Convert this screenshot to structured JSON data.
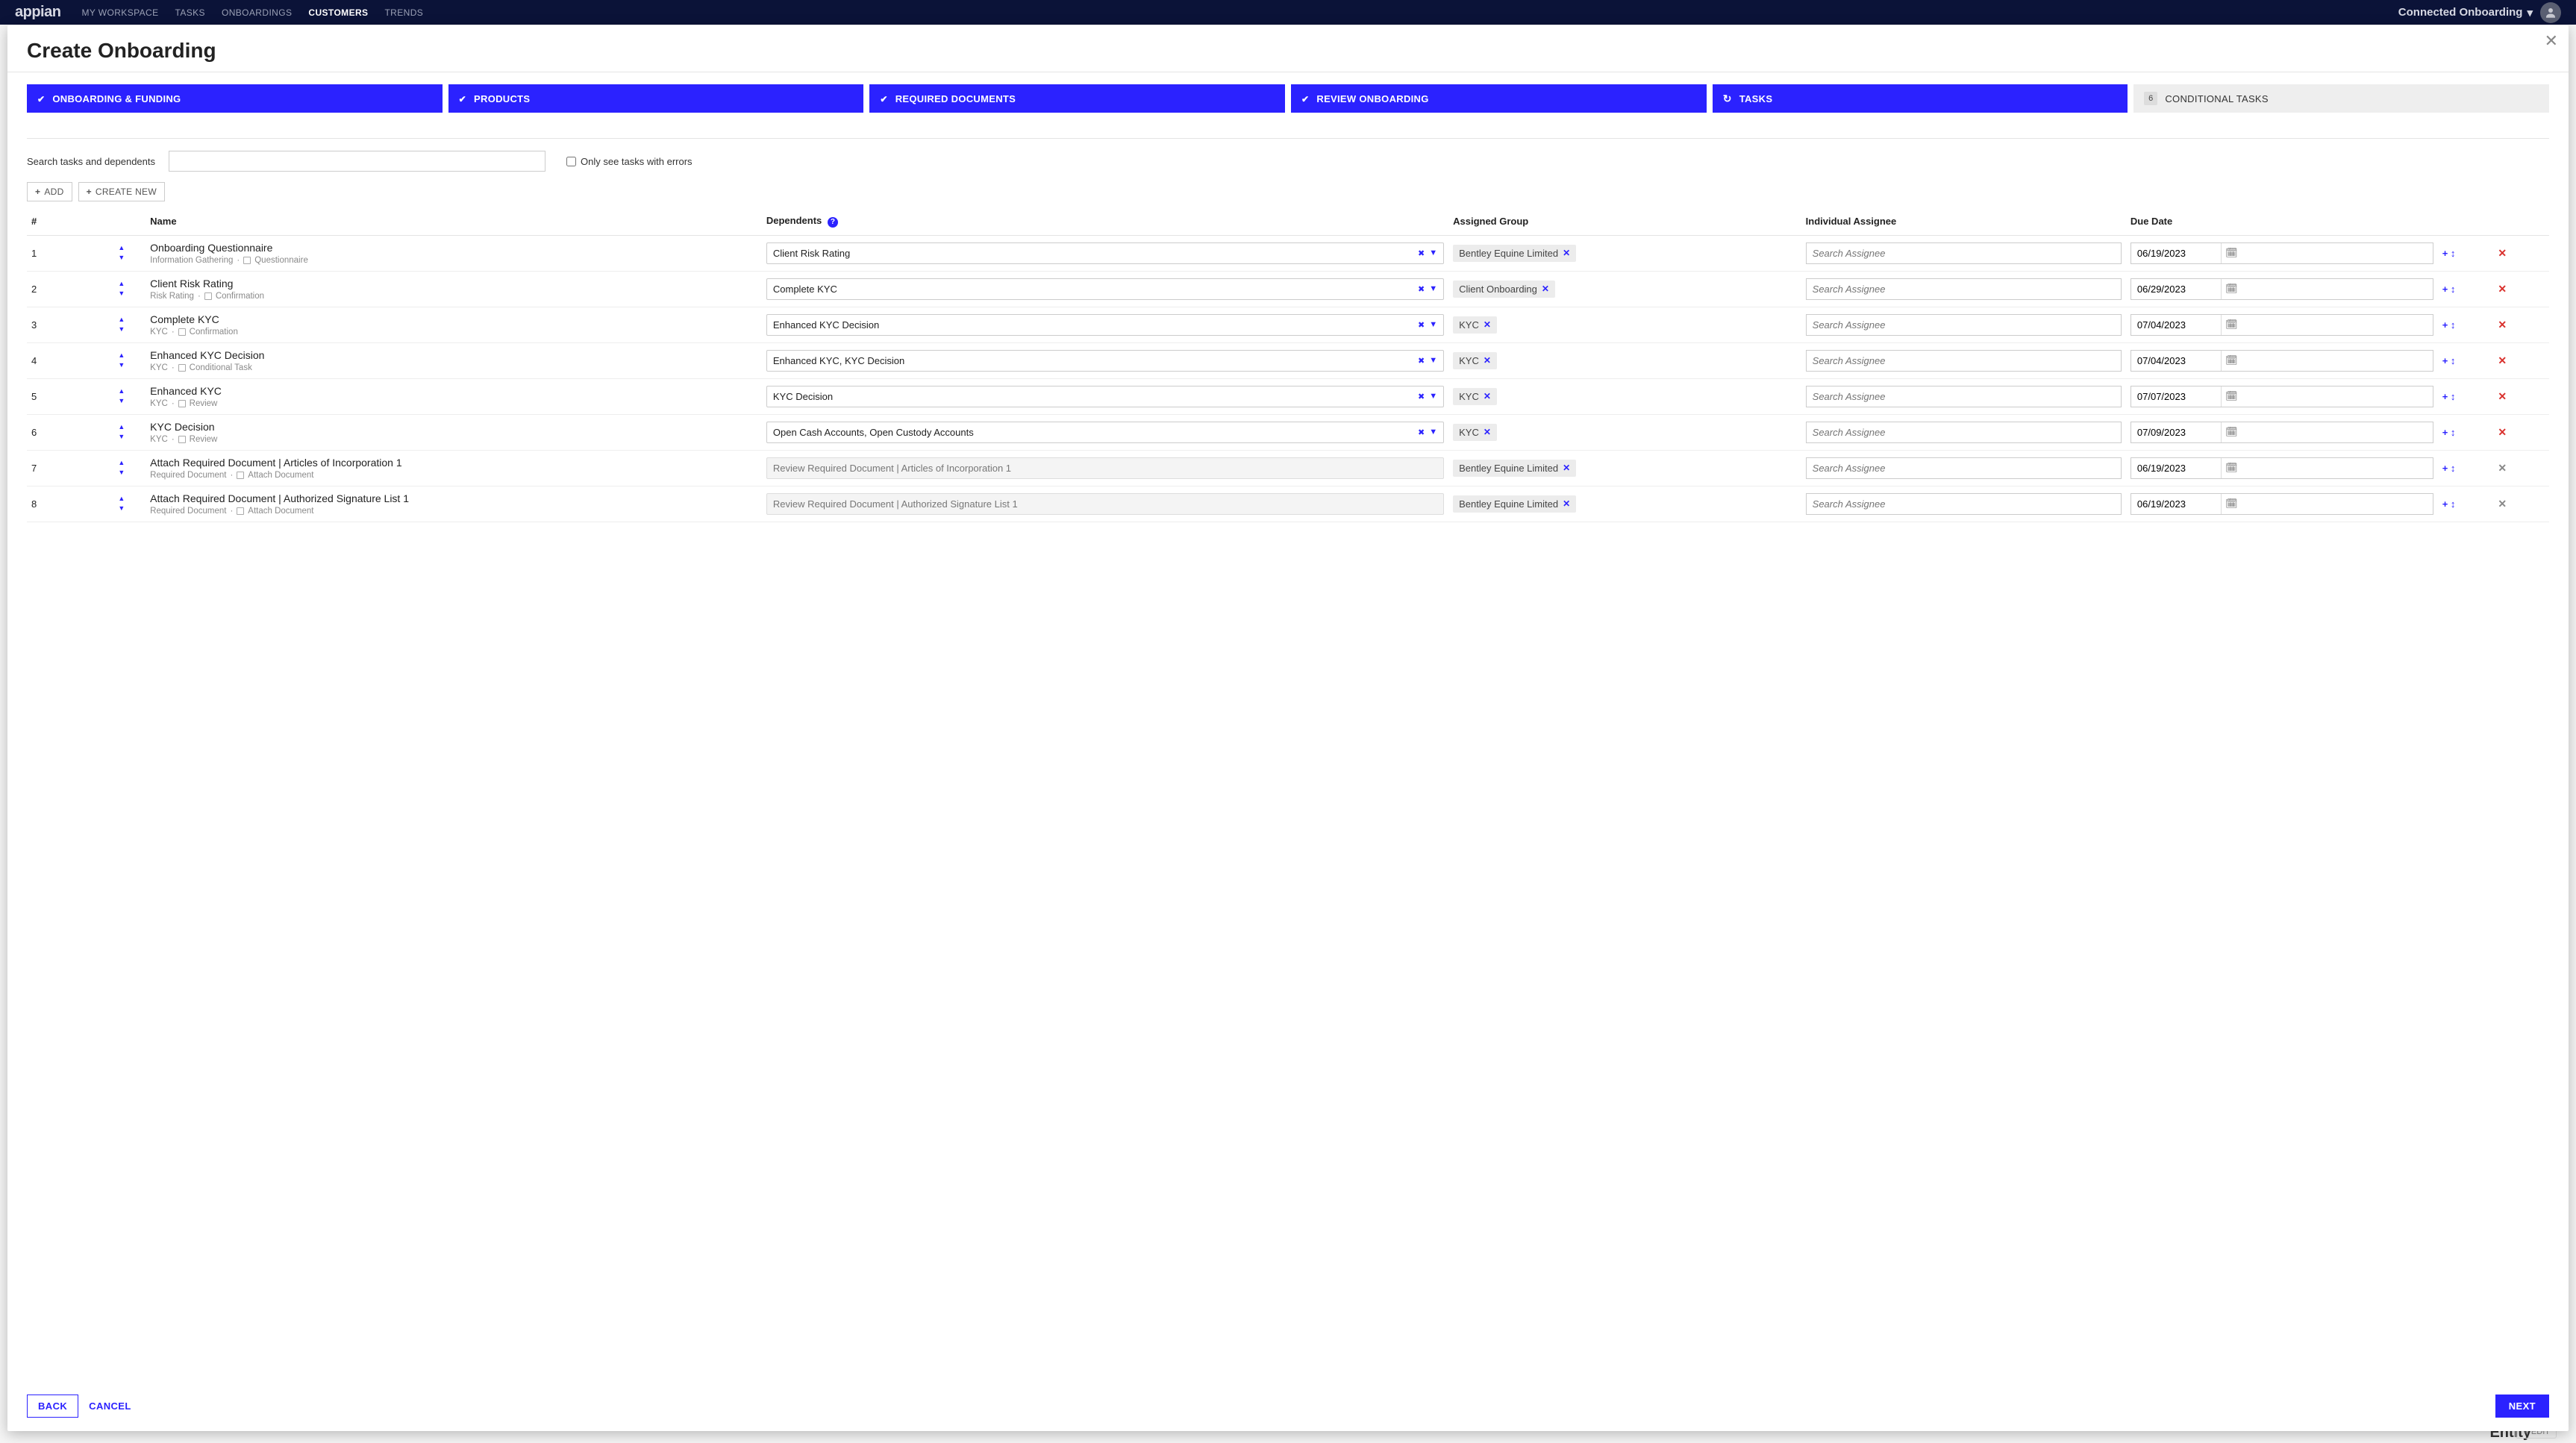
{
  "topbar": {
    "logo": "appian",
    "nav": [
      {
        "label": "MY WORKSPACE",
        "active": false
      },
      {
        "label": "TASKS",
        "active": false
      },
      {
        "label": "ONBOARDINGS",
        "active": false
      },
      {
        "label": "CUSTOMERS",
        "active": true
      },
      {
        "label": "TRENDS",
        "active": false
      }
    ],
    "app_name": "Connected Onboarding"
  },
  "modal": {
    "title": "Create Onboarding",
    "close_glyph": "✕"
  },
  "steps": [
    {
      "label": "ONBOARDING & FUNDING",
      "state": "done"
    },
    {
      "label": "PRODUCTS",
      "state": "done"
    },
    {
      "label": "REQUIRED DOCUMENTS",
      "state": "done"
    },
    {
      "label": "REVIEW ONBOARDING",
      "state": "done"
    },
    {
      "label": "TASKS",
      "state": "current"
    },
    {
      "num": "6",
      "label": "CONDITIONAL TASKS",
      "state": "pending"
    }
  ],
  "filter": {
    "search_label": "Search tasks and dependents",
    "search_value": "",
    "errors_label": "Only see tasks with errors",
    "errors_checked": false
  },
  "buttons": {
    "add": "ADD",
    "create_new": "CREATE NEW",
    "back": "BACK",
    "cancel": "CANCEL",
    "next": "NEXT"
  },
  "columns": {
    "num": "#",
    "name": "Name",
    "dependents": "Dependents",
    "assigned_group": "Assigned Group",
    "individual_assignee": "Individual Assignee",
    "due_date": "Due Date"
  },
  "assignee_placeholder": "Search Assignee",
  "tasks": [
    {
      "num": "1",
      "name": "Onboarding Questionnaire",
      "meta_cat": "Information Gathering",
      "meta_type": "Questionnaire",
      "dependent": "Client Risk Rating",
      "dep_readonly": false,
      "group": "Bentley Equine Limited",
      "due": "06/19/2023",
      "del_grey": false
    },
    {
      "num": "2",
      "name": "Client Risk Rating",
      "meta_cat": "Risk Rating",
      "meta_type": "Confirmation",
      "dependent": "Complete KYC",
      "dep_readonly": false,
      "group": "Client Onboarding",
      "due": "06/29/2023",
      "del_grey": false
    },
    {
      "num": "3",
      "name": "Complete KYC",
      "meta_cat": "KYC",
      "meta_type": "Confirmation",
      "dependent": "Enhanced KYC Decision",
      "dep_readonly": false,
      "group": "KYC",
      "due": "07/04/2023",
      "del_grey": false
    },
    {
      "num": "4",
      "name": "Enhanced KYC Decision",
      "meta_cat": "KYC",
      "meta_type": "Conditional Task",
      "dependent": "Enhanced KYC, KYC Decision",
      "dep_readonly": false,
      "group": "KYC",
      "due": "07/04/2023",
      "del_grey": false
    },
    {
      "num": "5",
      "name": "Enhanced KYC",
      "meta_cat": "KYC",
      "meta_type": "Review",
      "dependent": "KYC Decision",
      "dep_readonly": false,
      "group": "KYC",
      "due": "07/07/2023",
      "del_grey": false
    },
    {
      "num": "6",
      "name": "KYC Decision",
      "meta_cat": "KYC",
      "meta_type": "Review",
      "dependent": "Open Cash Accounts, Open Custody Accounts",
      "dep_readonly": false,
      "group": "KYC",
      "due": "07/09/2023",
      "del_grey": false
    },
    {
      "num": "7",
      "name": "Attach Required Document | Articles of Incorporation 1",
      "meta_cat": "Required Document",
      "meta_type": "Attach Document",
      "dependent": "Review Required Document | Articles of Incorporation 1",
      "dep_readonly": true,
      "group": "Bentley Equine Limited",
      "due": "06/19/2023",
      "del_grey": true
    },
    {
      "num": "8",
      "name": "Attach Required Document | Authorized Signature List 1",
      "meta_cat": "Required Document",
      "meta_type": "Attach Document",
      "dependent": "Review Required Document | Authorized Signature List 1",
      "dep_readonly": true,
      "group": "Bentley Equine Limited",
      "due": "06/19/2023",
      "del_grey": true
    }
  ],
  "background": {
    "entity_label": "Entity",
    "edit_label": "✎ EDIT"
  }
}
